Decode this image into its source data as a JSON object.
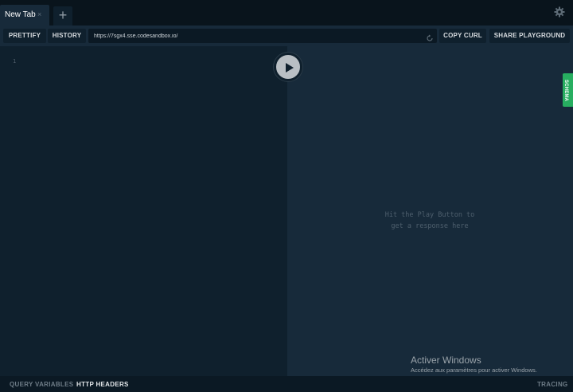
{
  "tabs": [
    {
      "title": "New Tab"
    }
  ],
  "tabbar": {
    "close_glyph": "×",
    "add_glyph": "+",
    "settings_icon": "gear-icon"
  },
  "toolbar": {
    "prettify_label": "PRETTIFY",
    "history_label": "HISTORY",
    "endpoint_url": "https://7sgx4.sse.codesandbox.io/",
    "reload_icon": "reload-icon",
    "copy_curl_label": "COPY CURL",
    "share_label": "SHARE PLAYGROUND"
  },
  "editor": {
    "line_number": "1"
  },
  "response": {
    "hint_line1": "Hit the Play Button to",
    "hint_line2": "get a response here"
  },
  "play_icon": "play-icon",
  "schema_tab": {
    "label": "SCHEMA",
    "color": "#27ae60"
  },
  "bottom": {
    "query_variables": "QUERY VARIABLES",
    "http_headers": "HTTP HEADERS",
    "tracing": "TRACING"
  },
  "watermark": {
    "title": "Activer Windows",
    "subtitle": "Accédez aux paramètres pour activer Windows."
  },
  "colors": {
    "background": "#0f202d",
    "panel": "#172a3a",
    "accent": "#27ae60"
  }
}
